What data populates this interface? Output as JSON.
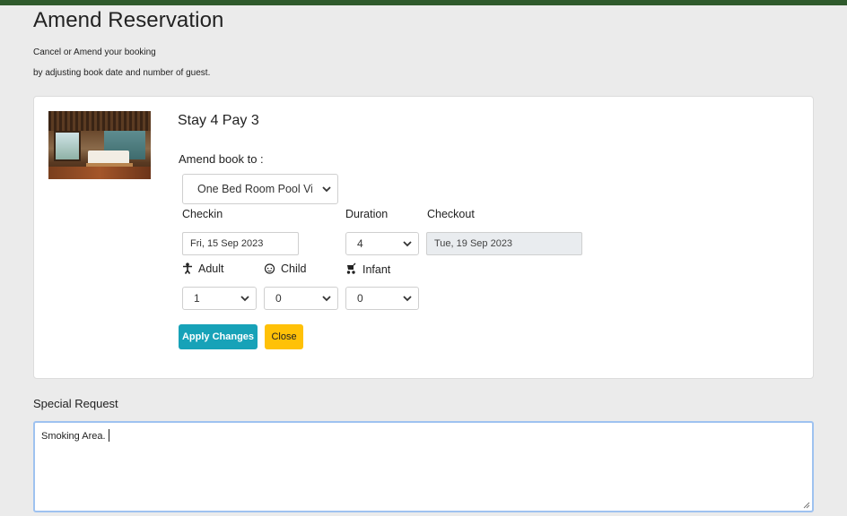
{
  "page": {
    "title": "Amend Reservation",
    "subtitle_line1": "Cancel or Amend your booking",
    "subtitle_line2": "by adjusting book date and number of guest."
  },
  "booking": {
    "offer_title": "Stay 4 Pay 3",
    "amend_label": "Amend book to :",
    "room_type": "One Bed Room Pool Villa",
    "checkin_label": "Checkin",
    "checkin_value": "Fri, 15 Sep 2023",
    "duration_label": "Duration",
    "duration_value": "4",
    "checkout_label": "Checkout",
    "checkout_value": "Tue, 19 Sep 2023",
    "adult_label": "Adult",
    "adult_value": "1",
    "child_label": "Child",
    "child_value": "0",
    "infant_label": "Infant",
    "infant_value": "0",
    "apply_label": "Apply Changes",
    "close_label": "Close"
  },
  "special_request": {
    "label": "Special Request",
    "value": "Smoking Area."
  },
  "colors": {
    "topbar": "#2f5a2c",
    "apply_button": "#17a2b8",
    "close_button": "#ffc107",
    "focus_border": "#9ec2f0"
  },
  "icons": {
    "adult": "person-icon",
    "child": "child-face-icon",
    "infant": "stroller-icon",
    "select": "chevron-down-icon"
  }
}
